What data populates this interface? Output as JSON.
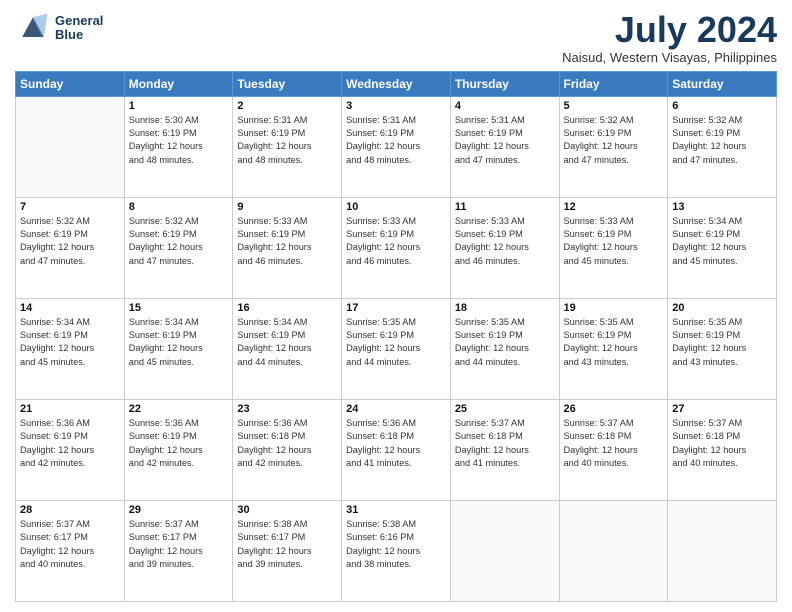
{
  "header": {
    "logo_line1": "General",
    "logo_line2": "Blue",
    "month": "July 2024",
    "location": "Naisud, Western Visayas, Philippines"
  },
  "weekdays": [
    "Sunday",
    "Monday",
    "Tuesday",
    "Wednesday",
    "Thursday",
    "Friday",
    "Saturday"
  ],
  "weeks": [
    [
      {
        "day": "",
        "info": ""
      },
      {
        "day": "1",
        "info": "Sunrise: 5:30 AM\nSunset: 6:19 PM\nDaylight: 12 hours\nand 48 minutes."
      },
      {
        "day": "2",
        "info": "Sunrise: 5:31 AM\nSunset: 6:19 PM\nDaylight: 12 hours\nand 48 minutes."
      },
      {
        "day": "3",
        "info": "Sunrise: 5:31 AM\nSunset: 6:19 PM\nDaylight: 12 hours\nand 48 minutes."
      },
      {
        "day": "4",
        "info": "Sunrise: 5:31 AM\nSunset: 6:19 PM\nDaylight: 12 hours\nand 47 minutes."
      },
      {
        "day": "5",
        "info": "Sunrise: 5:32 AM\nSunset: 6:19 PM\nDaylight: 12 hours\nand 47 minutes."
      },
      {
        "day": "6",
        "info": "Sunrise: 5:32 AM\nSunset: 6:19 PM\nDaylight: 12 hours\nand 47 minutes."
      }
    ],
    [
      {
        "day": "7",
        "info": "Sunrise: 5:32 AM\nSunset: 6:19 PM\nDaylight: 12 hours\nand 47 minutes."
      },
      {
        "day": "8",
        "info": "Sunrise: 5:32 AM\nSunset: 6:19 PM\nDaylight: 12 hours\nand 47 minutes."
      },
      {
        "day": "9",
        "info": "Sunrise: 5:33 AM\nSunset: 6:19 PM\nDaylight: 12 hours\nand 46 minutes."
      },
      {
        "day": "10",
        "info": "Sunrise: 5:33 AM\nSunset: 6:19 PM\nDaylight: 12 hours\nand 46 minutes."
      },
      {
        "day": "11",
        "info": "Sunrise: 5:33 AM\nSunset: 6:19 PM\nDaylight: 12 hours\nand 46 minutes."
      },
      {
        "day": "12",
        "info": "Sunrise: 5:33 AM\nSunset: 6:19 PM\nDaylight: 12 hours\nand 45 minutes."
      },
      {
        "day": "13",
        "info": "Sunrise: 5:34 AM\nSunset: 6:19 PM\nDaylight: 12 hours\nand 45 minutes."
      }
    ],
    [
      {
        "day": "14",
        "info": "Sunrise: 5:34 AM\nSunset: 6:19 PM\nDaylight: 12 hours\nand 45 minutes."
      },
      {
        "day": "15",
        "info": "Sunrise: 5:34 AM\nSunset: 6:19 PM\nDaylight: 12 hours\nand 45 minutes."
      },
      {
        "day": "16",
        "info": "Sunrise: 5:34 AM\nSunset: 6:19 PM\nDaylight: 12 hours\nand 44 minutes."
      },
      {
        "day": "17",
        "info": "Sunrise: 5:35 AM\nSunset: 6:19 PM\nDaylight: 12 hours\nand 44 minutes."
      },
      {
        "day": "18",
        "info": "Sunrise: 5:35 AM\nSunset: 6:19 PM\nDaylight: 12 hours\nand 44 minutes."
      },
      {
        "day": "19",
        "info": "Sunrise: 5:35 AM\nSunset: 6:19 PM\nDaylight: 12 hours\nand 43 minutes."
      },
      {
        "day": "20",
        "info": "Sunrise: 5:35 AM\nSunset: 6:19 PM\nDaylight: 12 hours\nand 43 minutes."
      }
    ],
    [
      {
        "day": "21",
        "info": "Sunrise: 5:36 AM\nSunset: 6:19 PM\nDaylight: 12 hours\nand 42 minutes."
      },
      {
        "day": "22",
        "info": "Sunrise: 5:36 AM\nSunset: 6:19 PM\nDaylight: 12 hours\nand 42 minutes."
      },
      {
        "day": "23",
        "info": "Sunrise: 5:36 AM\nSunset: 6:18 PM\nDaylight: 12 hours\nand 42 minutes."
      },
      {
        "day": "24",
        "info": "Sunrise: 5:36 AM\nSunset: 6:18 PM\nDaylight: 12 hours\nand 41 minutes."
      },
      {
        "day": "25",
        "info": "Sunrise: 5:37 AM\nSunset: 6:18 PM\nDaylight: 12 hours\nand 41 minutes."
      },
      {
        "day": "26",
        "info": "Sunrise: 5:37 AM\nSunset: 6:18 PM\nDaylight: 12 hours\nand 40 minutes."
      },
      {
        "day": "27",
        "info": "Sunrise: 5:37 AM\nSunset: 6:18 PM\nDaylight: 12 hours\nand 40 minutes."
      }
    ],
    [
      {
        "day": "28",
        "info": "Sunrise: 5:37 AM\nSunset: 6:17 PM\nDaylight: 12 hours\nand 40 minutes."
      },
      {
        "day": "29",
        "info": "Sunrise: 5:37 AM\nSunset: 6:17 PM\nDaylight: 12 hours\nand 39 minutes."
      },
      {
        "day": "30",
        "info": "Sunrise: 5:38 AM\nSunset: 6:17 PM\nDaylight: 12 hours\nand 39 minutes."
      },
      {
        "day": "31",
        "info": "Sunrise: 5:38 AM\nSunset: 6:16 PM\nDaylight: 12 hours\nand 38 minutes."
      },
      {
        "day": "",
        "info": ""
      },
      {
        "day": "",
        "info": ""
      },
      {
        "day": "",
        "info": ""
      }
    ]
  ]
}
